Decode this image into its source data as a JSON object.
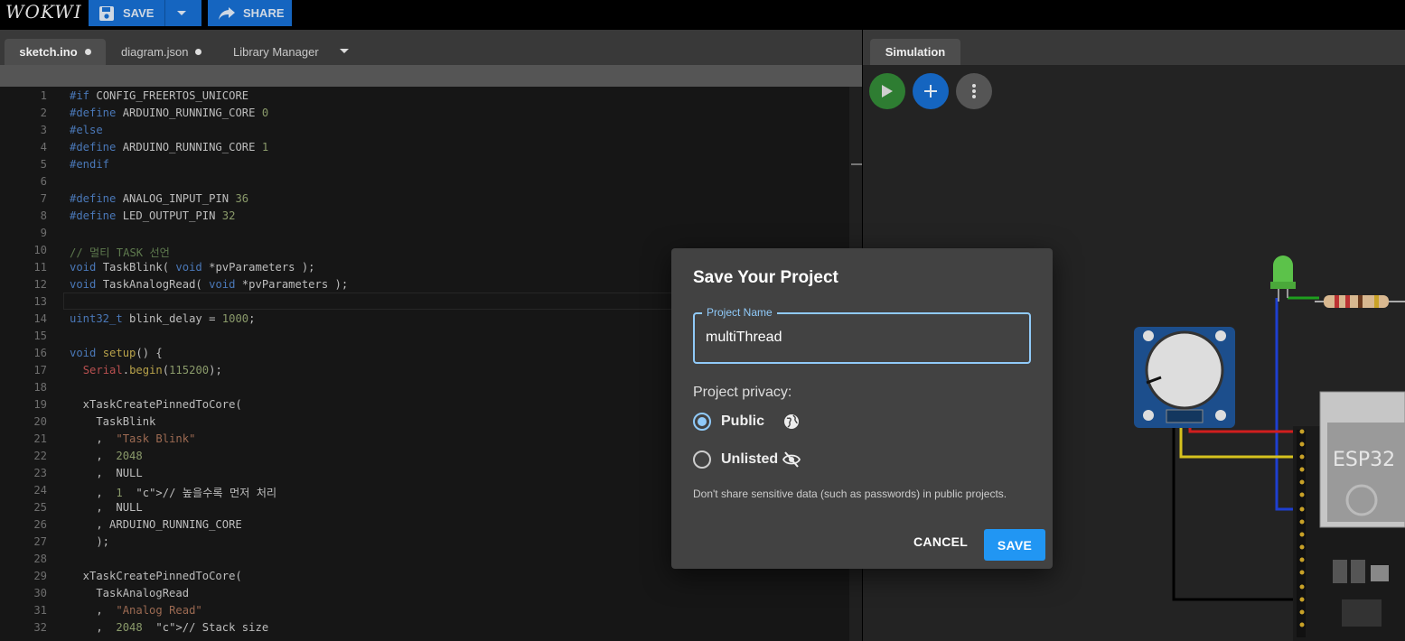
{
  "app": {
    "logo": "WOKWI"
  },
  "toolbar": {
    "save_label": "SAVE",
    "share_label": "SHARE"
  },
  "editor": {
    "tabs": [
      {
        "label": "sketch.ino",
        "modified": true,
        "active": true
      },
      {
        "label": "diagram.json",
        "modified": true,
        "active": false
      },
      {
        "label": "Library Manager",
        "modified": false,
        "active": false
      }
    ],
    "lines": [
      {
        "n": "1",
        "t": "#if CONFIG_FREERTOS_UNICORE"
      },
      {
        "n": "2",
        "t": "#define ARDUINO_RUNNING_CORE 0"
      },
      {
        "n": "3",
        "t": "#else"
      },
      {
        "n": "4",
        "t": "#define ARDUINO_RUNNING_CORE 1"
      },
      {
        "n": "5",
        "t": "#endif"
      },
      {
        "n": "6",
        "t": ""
      },
      {
        "n": "7",
        "t": "#define ANALOG_INPUT_PIN 36"
      },
      {
        "n": "8",
        "t": "#define LED_OUTPUT_PIN 32"
      },
      {
        "n": "9",
        "t": ""
      },
      {
        "n": "10",
        "t": "// 멀티 TASK 선언"
      },
      {
        "n": "11",
        "t": "void TaskBlink( void *pvParameters );"
      },
      {
        "n": "12",
        "t": "void TaskAnalogRead( void *pvParameters );"
      },
      {
        "n": "13",
        "t": ""
      },
      {
        "n": "14",
        "t": "uint32_t blink_delay = 1000;"
      },
      {
        "n": "15",
        "t": ""
      },
      {
        "n": "16",
        "t": "void setup() {"
      },
      {
        "n": "17",
        "t": "  Serial.begin(115200);"
      },
      {
        "n": "18",
        "t": ""
      },
      {
        "n": "19",
        "t": "  xTaskCreatePinnedToCore("
      },
      {
        "n": "20",
        "t": "    TaskBlink"
      },
      {
        "n": "21",
        "t": "    ,  \"Task Blink\""
      },
      {
        "n": "22",
        "t": "    ,  2048"
      },
      {
        "n": "23",
        "t": "    ,  NULL"
      },
      {
        "n": "24",
        "t": "    ,  1  // 높을수록 먼저 처리"
      },
      {
        "n": "25",
        "t": "    ,  NULL"
      },
      {
        "n": "26",
        "t": "    , ARDUINO_RUNNING_CORE"
      },
      {
        "n": "27",
        "t": "    );"
      },
      {
        "n": "28",
        "t": ""
      },
      {
        "n": "29",
        "t": "  xTaskCreatePinnedToCore("
      },
      {
        "n": "30",
        "t": "    TaskAnalogRead"
      },
      {
        "n": "31",
        "t": "    ,  \"Analog Read\""
      },
      {
        "n": "32",
        "t": "    ,  2048  // Stack size"
      }
    ]
  },
  "simulation": {
    "tab_label": "Simulation",
    "chip_label": "ESP32"
  },
  "dialog": {
    "title": "Save Your Project",
    "name_label": "Project Name",
    "name_value": "multiThread",
    "privacy_label": "Project privacy:",
    "options": [
      {
        "label": "Public",
        "selected": true
      },
      {
        "label": "Unlisted",
        "selected": false
      }
    ],
    "hint": "Don't share sensitive data (such as passwords) in public projects.",
    "cancel_label": "CANCEL",
    "save_label": "SAVE"
  },
  "colors": {
    "accent": "#2196f3",
    "field_focus": "#90caf9",
    "toolbar_button": "#1565c0"
  }
}
